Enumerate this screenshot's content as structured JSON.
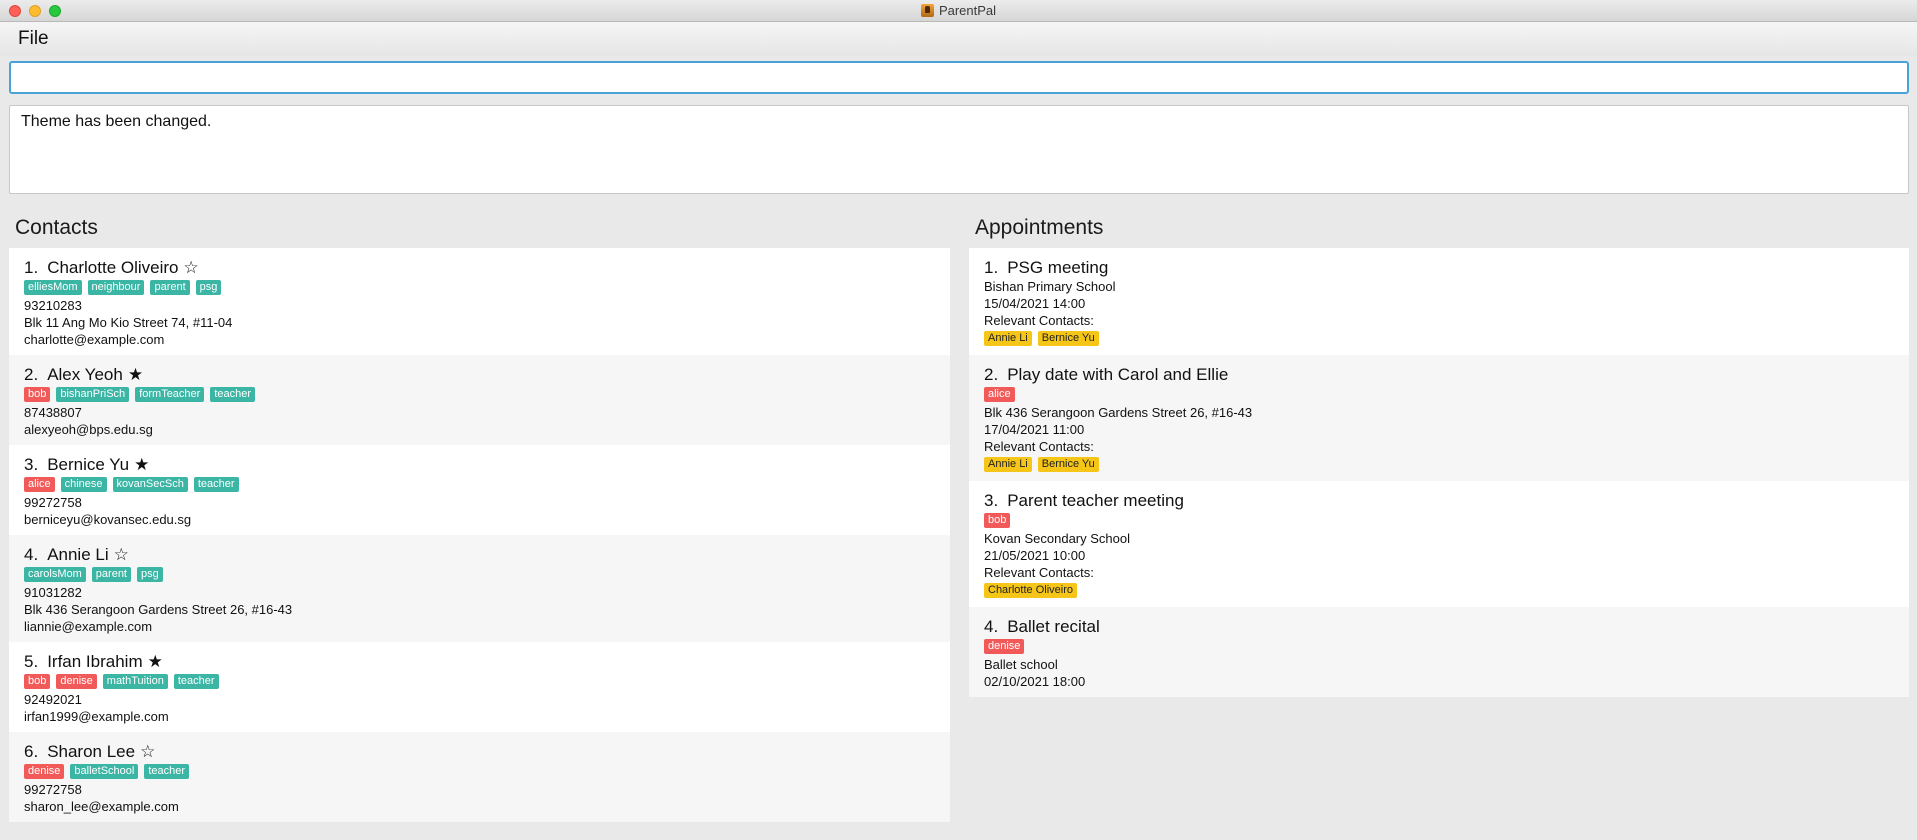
{
  "window": {
    "title": "ParentPal"
  },
  "menu": {
    "file": "File"
  },
  "command": {
    "value": ""
  },
  "result": {
    "text": "Theme has been changed."
  },
  "contacts": {
    "title": "Contacts",
    "items": [
      {
        "index": "1.",
        "name": "Charlotte Oliveiro",
        "star": "☆",
        "favorite": false,
        "tags": [
          {
            "text": "elliesMom",
            "color": "teal"
          },
          {
            "text": "neighbour",
            "color": "teal"
          },
          {
            "text": "parent",
            "color": "teal"
          },
          {
            "text": "psg",
            "color": "teal"
          }
        ],
        "lines": [
          "93210283",
          "Blk 11 Ang Mo Kio Street 74, #11-04",
          "charlotte@example.com"
        ]
      },
      {
        "index": "2.",
        "name": "Alex Yeoh",
        "star": "★",
        "favorite": true,
        "tags": [
          {
            "text": "bob",
            "color": "red"
          },
          {
            "text": "bishanPriSch",
            "color": "teal"
          },
          {
            "text": "formTeacher",
            "color": "teal"
          },
          {
            "text": "teacher",
            "color": "teal"
          }
        ],
        "lines": [
          "87438807",
          "alexyeoh@bps.edu.sg"
        ]
      },
      {
        "index": "3.",
        "name": "Bernice Yu",
        "star": "★",
        "favorite": true,
        "tags": [
          {
            "text": "alice",
            "color": "red"
          },
          {
            "text": "chinese",
            "color": "teal"
          },
          {
            "text": "kovanSecSch",
            "color": "teal"
          },
          {
            "text": "teacher",
            "color": "teal"
          }
        ],
        "lines": [
          "99272758",
          "berniceyu@kovansec.edu.sg"
        ]
      },
      {
        "index": "4.",
        "name": "Annie Li",
        "star": "☆",
        "favorite": false,
        "tags": [
          {
            "text": "carolsMom",
            "color": "teal"
          },
          {
            "text": "parent",
            "color": "teal"
          },
          {
            "text": "psg",
            "color": "teal"
          }
        ],
        "lines": [
          "91031282",
          "Blk 436 Serangoon Gardens Street 26, #16-43",
          "liannie@example.com"
        ]
      },
      {
        "index": "5.",
        "name": "Irfan Ibrahim",
        "star": "★",
        "favorite": true,
        "tags": [
          {
            "text": "bob",
            "color": "red"
          },
          {
            "text": "denise",
            "color": "red"
          },
          {
            "text": "mathTuition",
            "color": "teal"
          },
          {
            "text": "teacher",
            "color": "teal"
          }
        ],
        "lines": [
          "92492021",
          "irfan1999@example.com"
        ]
      },
      {
        "index": "6.",
        "name": "Sharon Lee",
        "star": "☆",
        "favorite": false,
        "tags": [
          {
            "text": "denise",
            "color": "red"
          },
          {
            "text": "balletSchool",
            "color": "teal"
          },
          {
            "text": "teacher",
            "color": "teal"
          }
        ],
        "lines": [
          "99272758",
          "sharon_lee@example.com"
        ]
      }
    ]
  },
  "appointments": {
    "title": "Appointments",
    "items": [
      {
        "index": "1.",
        "name": "PSG meeting",
        "tags": [],
        "lines": [
          "Bishan Primary School",
          "15/04/2021 14:00",
          "Relevant Contacts:"
        ],
        "contacts": [
          "Annie Li",
          "Bernice Yu"
        ]
      },
      {
        "index": "2.",
        "name": "Play date with Carol and Ellie",
        "tags": [
          {
            "text": "alice",
            "color": "red"
          }
        ],
        "lines": [
          "Blk 436 Serangoon Gardens Street 26, #16-43",
          "17/04/2021 11:00",
          "Relevant Contacts:"
        ],
        "contacts": [
          "Annie Li",
          "Bernice Yu"
        ]
      },
      {
        "index": "3.",
        "name": "Parent teacher meeting",
        "tags": [
          {
            "text": "bob",
            "color": "red"
          }
        ],
        "lines": [
          "Kovan Secondary School",
          "21/05/2021 10:00",
          "Relevant Contacts:"
        ],
        "contacts": [
          "Charlotte Oliveiro"
        ]
      },
      {
        "index": "4.",
        "name": "Ballet recital",
        "tags": [
          {
            "text": "denise",
            "color": "red"
          }
        ],
        "lines": [
          "Ballet school",
          "02/10/2021 18:00"
        ],
        "contacts": []
      }
    ]
  },
  "colors": {
    "teal": "#3bb5a4",
    "red": "#f25a5a",
    "yellow": "#f5c518",
    "focus": "#48a3d8"
  }
}
